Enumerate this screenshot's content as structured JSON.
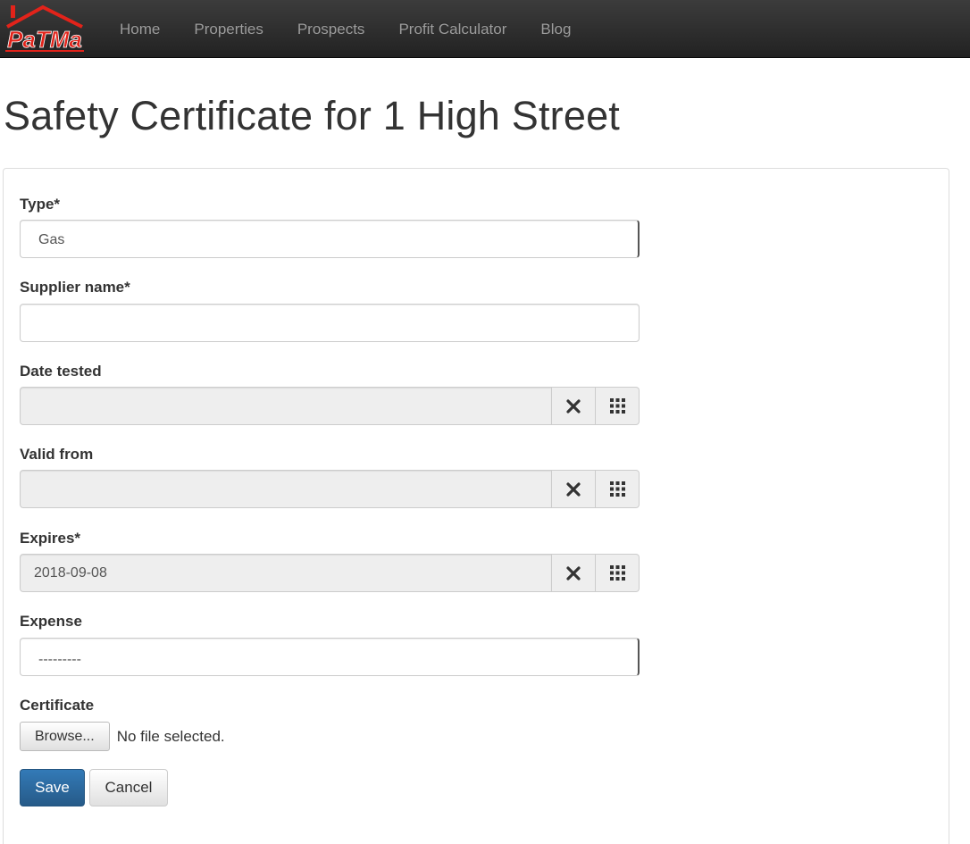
{
  "navbar": {
    "brand": "PaTMa",
    "links": [
      "Home",
      "Properties",
      "Prospects",
      "Profit Calculator",
      "Blog"
    ]
  },
  "page": {
    "title": "Safety Certificate for 1 High Street"
  },
  "form": {
    "type": {
      "label": "Type*",
      "value": "Gas"
    },
    "supplier_name": {
      "label": "Supplier name*",
      "value": ""
    },
    "date_tested": {
      "label": "Date tested",
      "value": ""
    },
    "valid_from": {
      "label": "Valid from",
      "value": ""
    },
    "expires": {
      "label": "Expires*",
      "value": "2018-09-08"
    },
    "expense": {
      "label": "Expense",
      "value": "---------"
    },
    "certificate": {
      "label": "Certificate",
      "browse_label": "Browse...",
      "status": "No file selected."
    },
    "save_label": "Save",
    "cancel_label": "Cancel"
  },
  "icons": {
    "clear": "close-icon",
    "calendar": "calendar-grid-icon"
  },
  "colors": {
    "brand_red": "#e2231a",
    "primary": "#337ab7",
    "navbar": "#222222"
  }
}
